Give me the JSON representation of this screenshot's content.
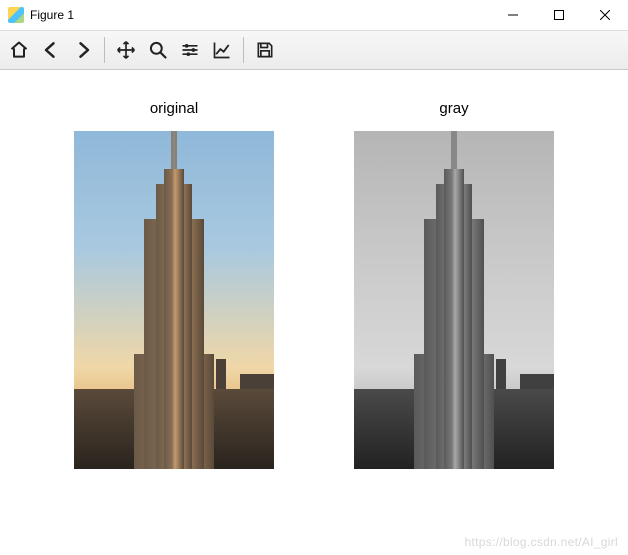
{
  "window": {
    "title": "Figure 1"
  },
  "toolbar": {
    "home": "home-icon",
    "back": "arrow-left-icon",
    "forward": "arrow-right-icon",
    "pan": "move-icon",
    "zoom": "zoom-icon",
    "subplots": "sliders-icon",
    "edit": "chart-icon",
    "save": "save-icon"
  },
  "plots": {
    "left_title": "original",
    "right_title": "gray"
  },
  "watermark": "https://blog.csdn.net/AI_girl"
}
